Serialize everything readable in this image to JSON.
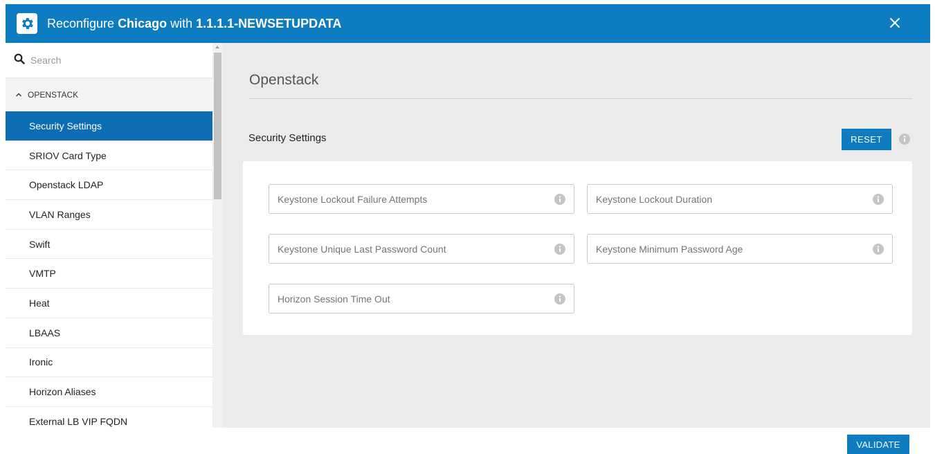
{
  "header": {
    "title_prefix": "Reconfigure ",
    "title_site": "Chicago",
    "title_middle": " with ",
    "title_version": "1.1.1.1-NEWSETUPDATA",
    "close_icon": "close-icon",
    "app_icon": "gear-icon"
  },
  "sidebar": {
    "search_placeholder": "Search",
    "group_label": "OPENSTACK",
    "items": [
      {
        "label": "Security Settings",
        "active": true
      },
      {
        "label": "SRIOV Card Type"
      },
      {
        "label": "Openstack LDAP"
      },
      {
        "label": "VLAN Ranges"
      },
      {
        "label": "Swift"
      },
      {
        "label": "VMTP"
      },
      {
        "label": "Heat"
      },
      {
        "label": "LBAAS"
      },
      {
        "label": "Ironic"
      },
      {
        "label": "Horizon Aliases"
      },
      {
        "label": "External LB VIP FQDN"
      }
    ]
  },
  "main": {
    "page_title": "Openstack",
    "section_title": "Security Settings",
    "reset_label": "RESET",
    "fields": [
      {
        "placeholder": "Keystone Lockout Failure Attempts",
        "value": ""
      },
      {
        "placeholder": "Keystone Lockout Duration",
        "value": ""
      },
      {
        "placeholder": "Keystone Unique Last Password Count",
        "value": ""
      },
      {
        "placeholder": "Keystone Minimum Password Age",
        "value": ""
      },
      {
        "placeholder": "Horizon Session Time Out",
        "value": ""
      }
    ]
  },
  "footer": {
    "validate_label": "VALIDATE"
  },
  "colors": {
    "primary": "#0d7cc1",
    "active_item": "#0d6db3",
    "content_bg": "#ebebeb"
  }
}
